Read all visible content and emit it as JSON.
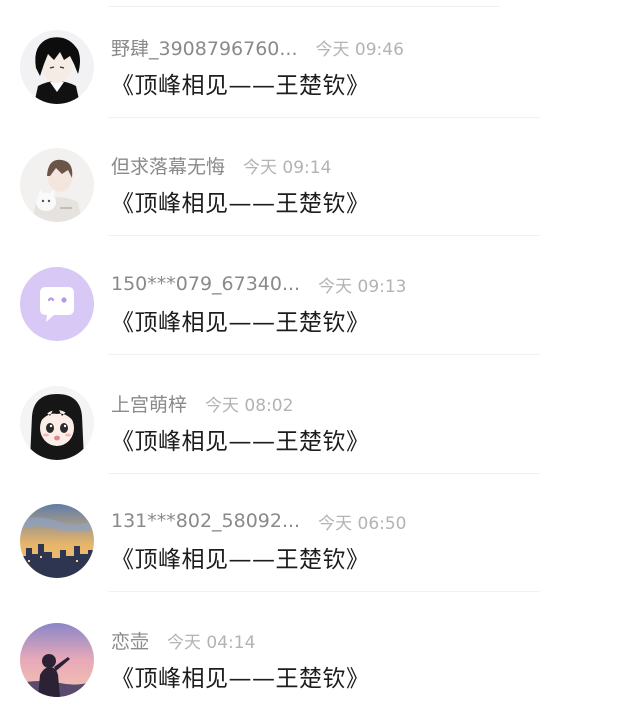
{
  "comments": [
    {
      "username": "野肆_3908796760...",
      "time": "今天 09:46",
      "text": "《顶峰相见——王楚钦》",
      "avatar_icon": "anime-boy-dark-hair-avatar-icon"
    },
    {
      "username": "但求落幕无悔",
      "time": "今天 09:14",
      "text": "《顶峰相见——王楚钦》",
      "avatar_icon": "boy-holding-cat-avatar-icon"
    },
    {
      "username": "150***079_67340...",
      "time": "今天 09:13",
      "text": "《顶峰相见——王楚钦》",
      "avatar_icon": "default-chat-bubble-avatar-icon",
      "avatar_color": "#d8c8f5"
    },
    {
      "username": "上宫萌梓",
      "time": "今天 08:02",
      "text": "《顶峰相见——王楚钦》",
      "avatar_icon": "anime-girl-avatar-icon"
    },
    {
      "username": "131***802_58092...",
      "time": "今天 06:50",
      "text": "《顶峰相见——王楚钦》",
      "avatar_icon": "city-sunset-avatar-icon"
    },
    {
      "username": "恋壶",
      "time": "今天 04:14",
      "text": "《顶峰相见——王楚钦》",
      "avatar_icon": "girl-sunset-silhouette-avatar-icon"
    }
  ]
}
